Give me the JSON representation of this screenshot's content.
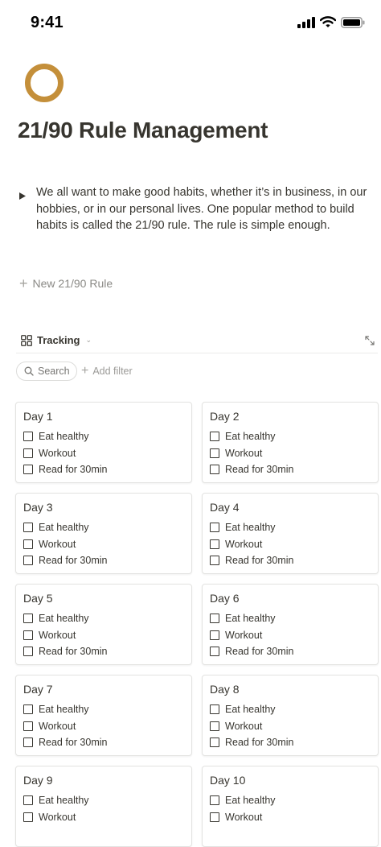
{
  "status": {
    "time": "9:41"
  },
  "page": {
    "title": "21/90 Rule Management",
    "icon": "circle-ring-icon",
    "icon_color": "#C48F3A"
  },
  "intro": {
    "text": "We all want to make good habits, whether it’s in business, in our hobbies, or in our personal lives. One popular method to build habits is called the 21/90 rule. The rule is simple enough."
  },
  "new_rule": {
    "label": "New 21/90 Rule"
  },
  "view": {
    "label": "Tracking"
  },
  "toolbar": {
    "search_label": "Search",
    "add_filter_label": "Add filter"
  },
  "cards": [
    {
      "title": "Day 1",
      "tasks": [
        "Eat healthy",
        "Workout",
        "Read for 30min"
      ]
    },
    {
      "title": "Day 2",
      "tasks": [
        "Eat healthy",
        "Workout",
        "Read for 30min"
      ]
    },
    {
      "title": "Day 3",
      "tasks": [
        "Eat healthy",
        "Workout",
        "Read for 30min"
      ]
    },
    {
      "title": "Day 4",
      "tasks": [
        "Eat healthy",
        "Workout",
        "Read for 30min"
      ]
    },
    {
      "title": "Day 5",
      "tasks": [
        "Eat healthy",
        "Workout",
        "Read for 30min"
      ]
    },
    {
      "title": "Day 6",
      "tasks": [
        "Eat healthy",
        "Workout",
        "Read for 30min"
      ]
    },
    {
      "title": "Day 7",
      "tasks": [
        "Eat healthy",
        "Workout",
        "Read for 30min"
      ]
    },
    {
      "title": "Day 8",
      "tasks": [
        "Eat healthy",
        "Workout",
        "Read for 30min"
      ]
    },
    {
      "title": "Day 9",
      "tasks": [
        "Eat healthy",
        "Workout"
      ]
    },
    {
      "title": "Day 10",
      "tasks": [
        "Eat healthy",
        "Workout"
      ]
    }
  ]
}
